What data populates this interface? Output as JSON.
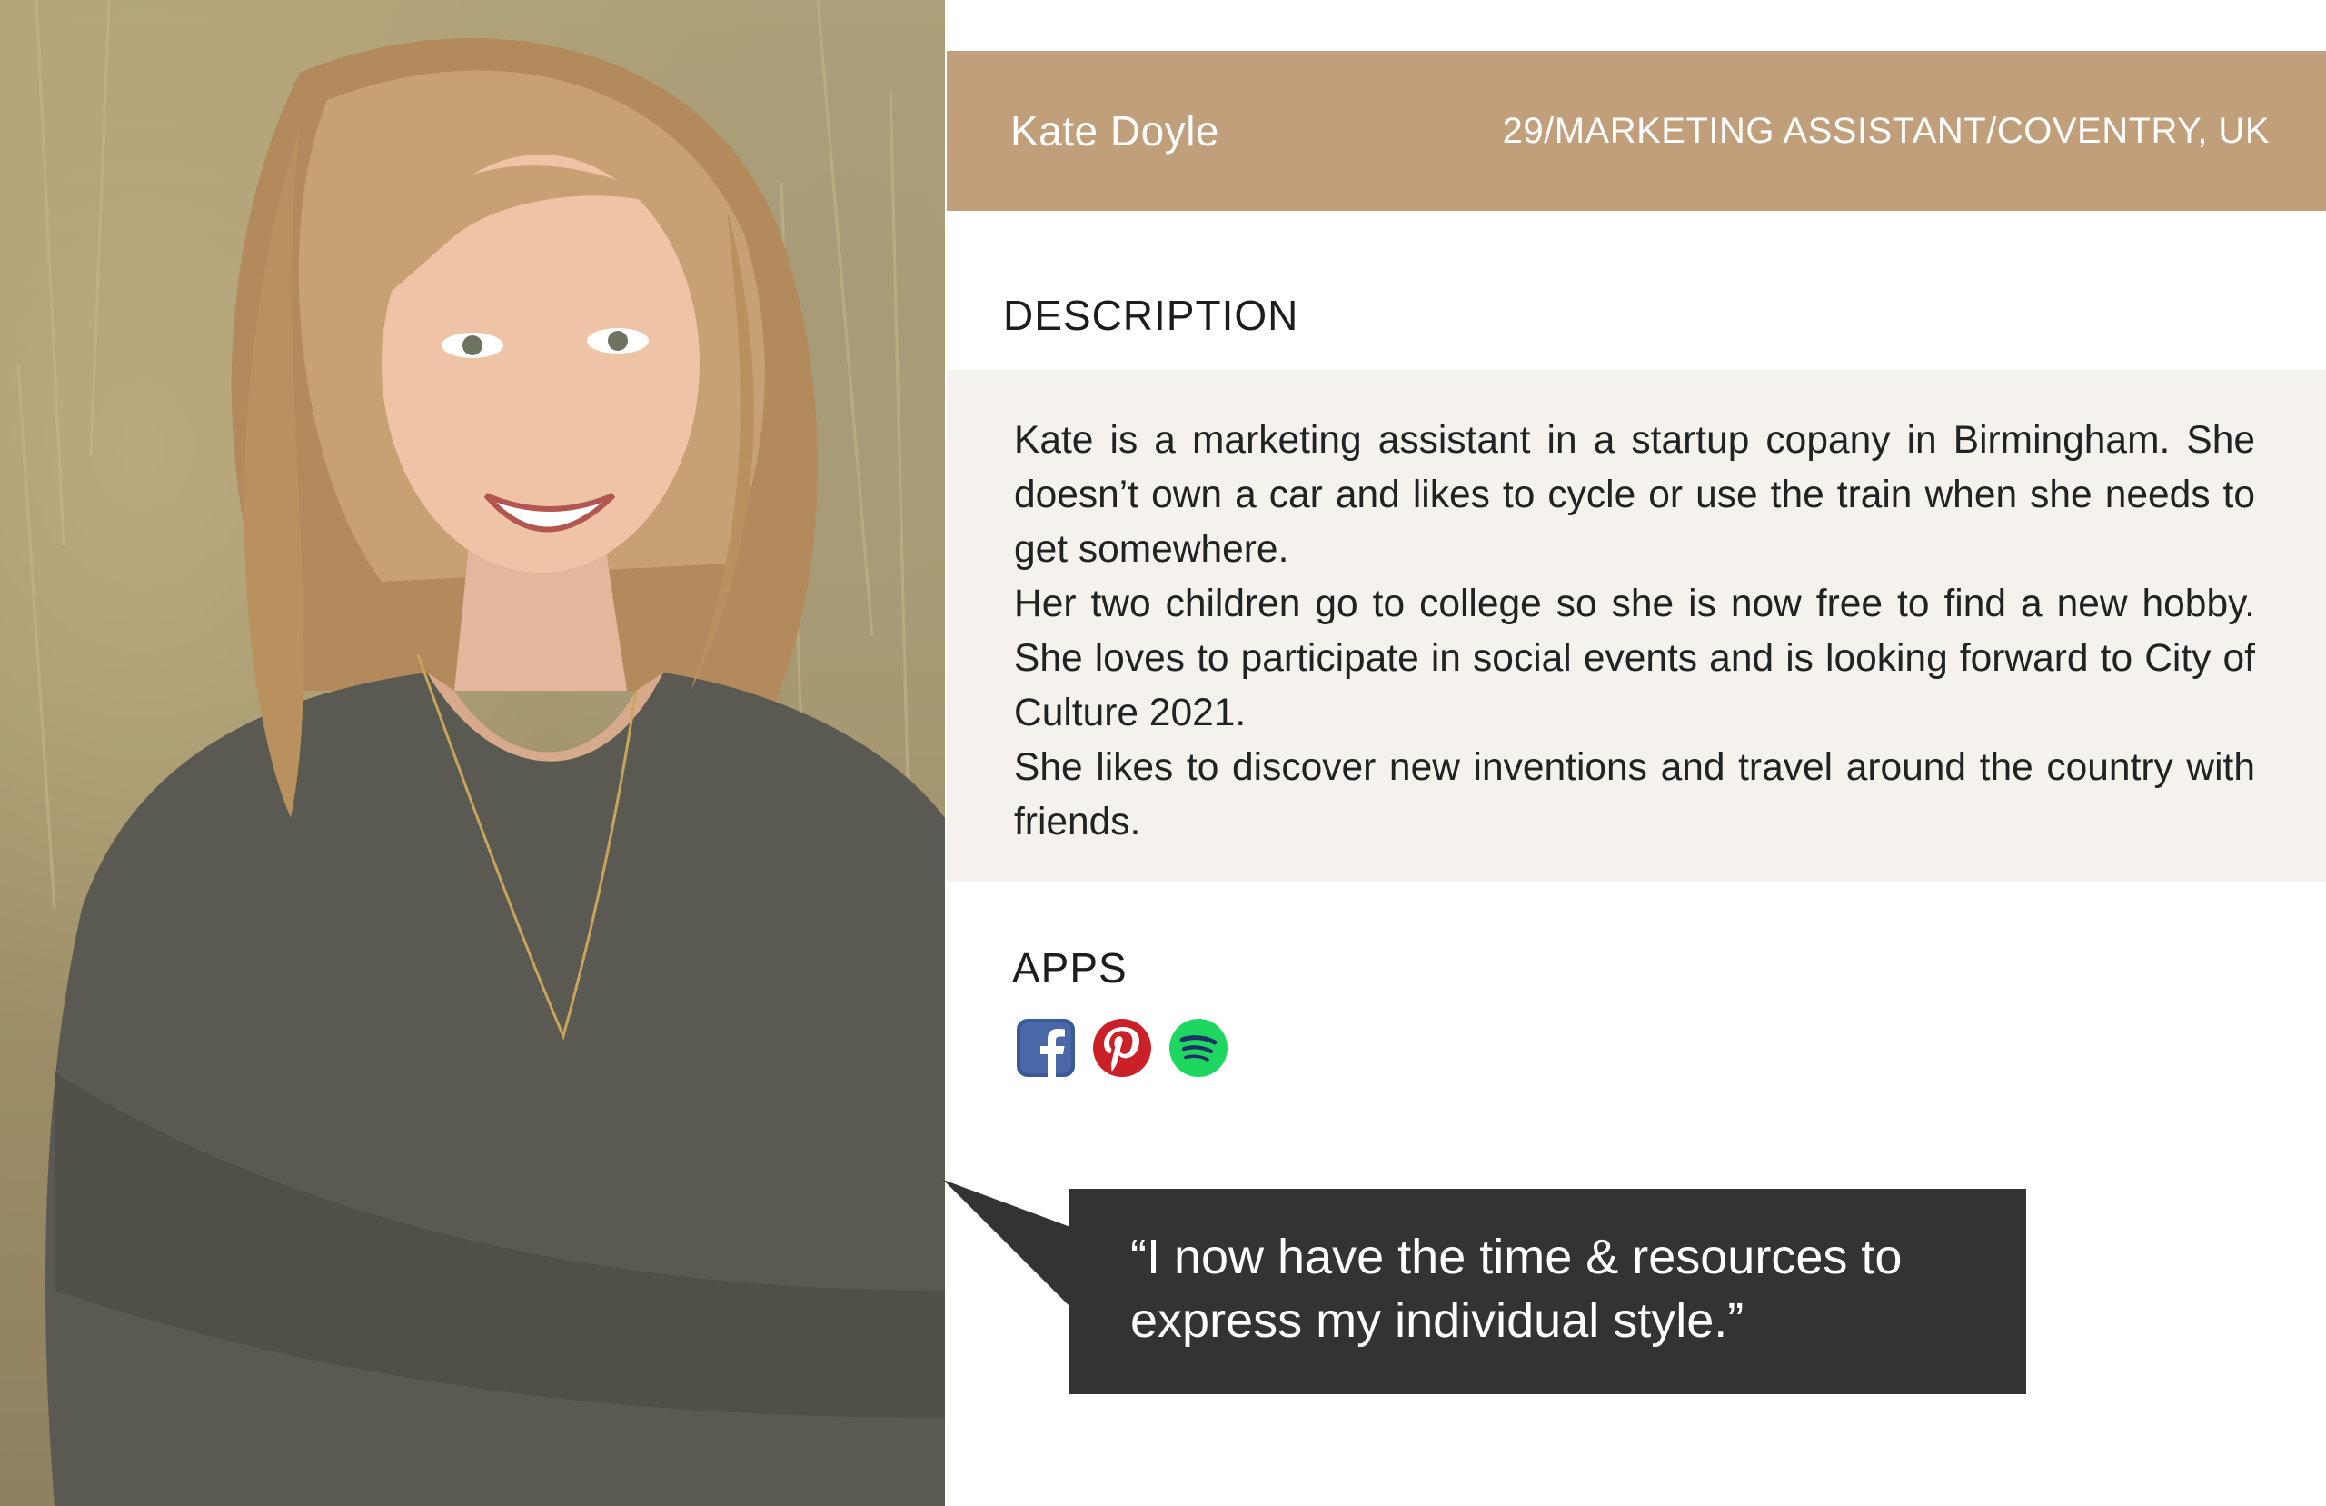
{
  "persona": {
    "name": "Kate Doyle",
    "meta": "29/MARKETING ASSISTANT/COVENTRY, UK"
  },
  "description": {
    "title": "DESCRIPTION",
    "paragraphs": [
      "Kate is a marketing assistant in a startup copany in Birmingham. She doesn’t own a car and likes to cycle or use the train when she needs to get somewhere.",
      "Her two children go to college so she is now free to find a new hobby. She loves to participate in social events and is looking forward to City of Culture 2021.",
      "She likes to discover new inventions and travel around the country with friends."
    ]
  },
  "apps": {
    "title": "APPS",
    "icons": [
      "facebook-icon",
      "pinterest-icon",
      "spotify-icon"
    ]
  },
  "quote": {
    "text": "“I now have the time & resources to express my individual style.”"
  },
  "colors": {
    "header_band": "#c19f7a",
    "description_bg": "#f5f2ee",
    "quote_bg": "#333333",
    "facebook": "#3b5998",
    "pinterest": "#cb2027",
    "spotify": "#1ed760"
  }
}
